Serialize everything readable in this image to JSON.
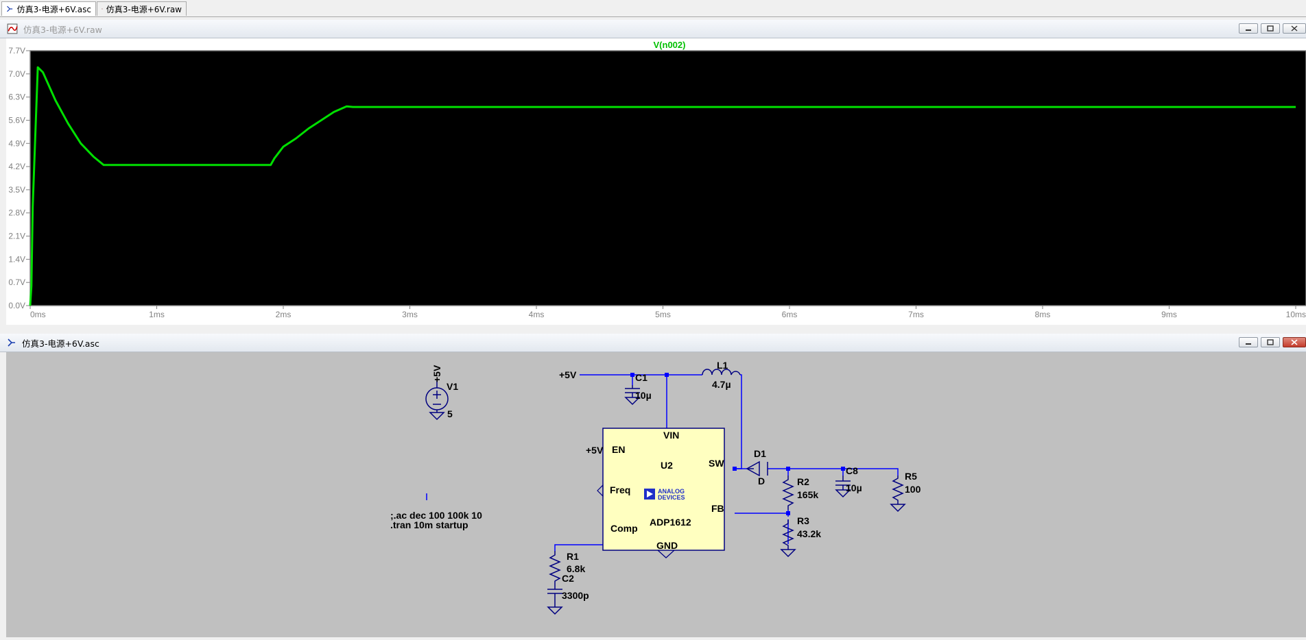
{
  "tabs": [
    {
      "label": "仿真3-电源+6V.asc",
      "active": true,
      "icon": "schematic-icon"
    },
    {
      "label": "仿真3-电源+6V.raw",
      "active": false,
      "icon": "waveform-icon"
    }
  ],
  "waveform_window": {
    "title": "仿真3-电源+6V.raw",
    "title_color": "#9a9a9a"
  },
  "schematic_window": {
    "title": "仿真3-电源+6V.asc"
  },
  "chart_data": {
    "type": "line",
    "title": "V(n002)",
    "series": [
      {
        "name": "V(n002)",
        "color": "#00e000",
        "x_ms": [
          0,
          0.01,
          0.02,
          0.04,
          0.06,
          0.1,
          0.2,
          0.3,
          0.4,
          0.5,
          0.58,
          1.0,
          1.5,
          1.9,
          1.93,
          1.96,
          2.0,
          2.1,
          2.2,
          2.3,
          2.4,
          2.5,
          2.55,
          3,
          4,
          5,
          6,
          7,
          8,
          9,
          10
        ],
        "y_v": [
          0,
          0.6,
          3.0,
          5.1,
          7.2,
          7.05,
          6.2,
          5.5,
          4.9,
          4.5,
          4.25,
          4.25,
          4.25,
          4.25,
          4.45,
          4.6,
          4.8,
          5.05,
          5.35,
          5.6,
          5.85,
          6.02,
          6.0,
          6.0,
          6.0,
          6.0,
          6.0,
          6.0,
          6.0,
          6.0,
          6.0
        ]
      }
    ],
    "y_ticks": [
      "0.0V",
      "0.7V",
      "1.4V",
      "2.1V",
      "2.8V",
      "3.5V",
      "4.2V",
      "4.9V",
      "5.6V",
      "6.3V",
      "7.0V",
      "7.7V"
    ],
    "x_ticks": [
      "0ms",
      "1ms",
      "2ms",
      "3ms",
      "4ms",
      "5ms",
      "6ms",
      "7ms",
      "8ms",
      "9ms",
      "10ms"
    ],
    "xlim": [
      0,
      10
    ],
    "ylim": [
      0,
      7.7
    ],
    "grid": false,
    "background": "#000000",
    "axis_color": "#808080"
  },
  "schematic": {
    "colors": {
      "wire": "#0000ff",
      "component": "#000080",
      "ic_fill": "#ffffc0",
      "background": "#c0c0c0"
    },
    "net_5v": "+5V",
    "c1": {
      "name": "C1",
      "value": "10µ"
    },
    "l1": {
      "name": "L1",
      "value": "4.7µ"
    },
    "u2": {
      "name": "U2",
      "part": "ADP1612",
      "pins": {
        "vin": "VIN",
        "en": "EN",
        "sw": "SW",
        "freq": "Freq",
        "fb": "FB",
        "comp": "Comp",
        "gnd": "GND"
      },
      "en_net": "+5V",
      "logo": [
        "ANALOG",
        "DEVICES"
      ]
    },
    "d1": {
      "name": "D1",
      "value": "D"
    },
    "r2": {
      "name": "R2",
      "value": "165k"
    },
    "c8": {
      "name": "C8",
      "value": "10µ"
    },
    "r5": {
      "name": "R5",
      "value": "100"
    },
    "r3": {
      "name": "R3",
      "value": "43.2k"
    },
    "r1": {
      "name": "R1",
      "value": "6.8k"
    },
    "c2": {
      "name": "C2",
      "value": "3300p"
    },
    "v1": {
      "name": "V1",
      "value": "5",
      "net": "+5V"
    },
    "directives": [
      ";.ac dec 100 100k 10",
      ".tran 10m startup"
    ]
  }
}
